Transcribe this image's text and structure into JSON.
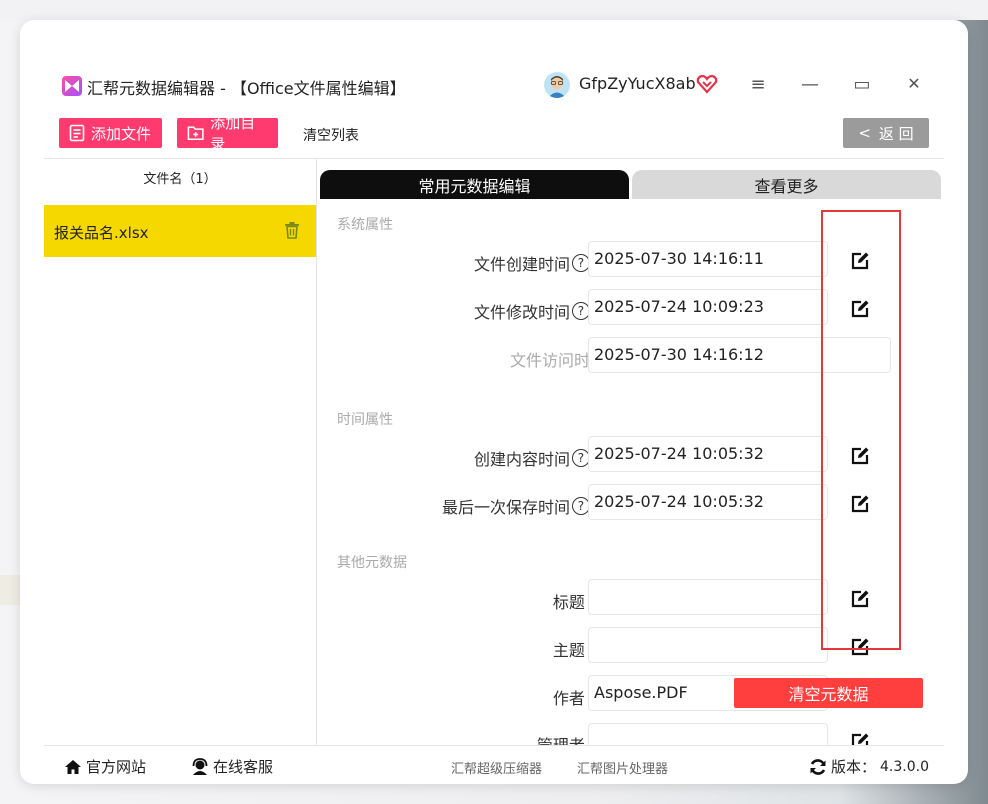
{
  "window": {
    "title": "汇帮元数据编辑器 - 【Office文件属性编辑】",
    "username": "GfpZyYucX8ab",
    "controls": {
      "menu": "≡",
      "minimize": "—",
      "maximize": "▭",
      "close": "✕"
    }
  },
  "toolbar": {
    "add_file": "添加文件",
    "add_dir": "添加目录",
    "clear_list": "清空列表",
    "back": "返 回",
    "back_arrow": "<"
  },
  "file_list": {
    "header": "文件名（1）",
    "items": [
      {
        "name": "报关品名.xlsx"
      }
    ]
  },
  "tabs": {
    "common": "常用元数据编辑",
    "more": "查看更多"
  },
  "sections": {
    "system": "系统属性",
    "time": "时间属性",
    "other": "其他元数据"
  },
  "fields": {
    "created": {
      "label": "文件创建时间",
      "value": "2025-07-30 14:16:11"
    },
    "modified": {
      "label": "文件修改时间",
      "value": "2025-07-24 10:09:23"
    },
    "accessed": {
      "label": "文件访问时间",
      "value": "2025-07-30 14:16:12"
    },
    "content_created": {
      "label": "创建内容时间",
      "value": "2025-07-24 10:05:32"
    },
    "last_saved": {
      "label": "最后一次保存时间",
      "value": "2025-07-24 10:05:32"
    },
    "title": {
      "label": "标题 ：",
      "value": ""
    },
    "subject": {
      "label": "主题 ：",
      "value": ""
    },
    "author": {
      "label": "作者 ：",
      "value": "Aspose.PDF"
    },
    "manager": {
      "label": "管理者 ：",
      "value": ""
    }
  },
  "colon": "：",
  "qmark": "?",
  "clear_metadata": "清空元数据",
  "footer": {
    "website": "官方网站",
    "support": "在线客服",
    "compressor": "汇帮超级压缩器",
    "image_tool": "汇帮图片处理器",
    "version_label": "版本：",
    "version": "4.3.0.0"
  },
  "colors": {
    "accent_pink": "#ff3a6e",
    "selected_row": "#f5d800",
    "clear_button": "#ff3e3e",
    "highlight_box": "#e23a3a",
    "tab_active": "#0e0e0e"
  }
}
